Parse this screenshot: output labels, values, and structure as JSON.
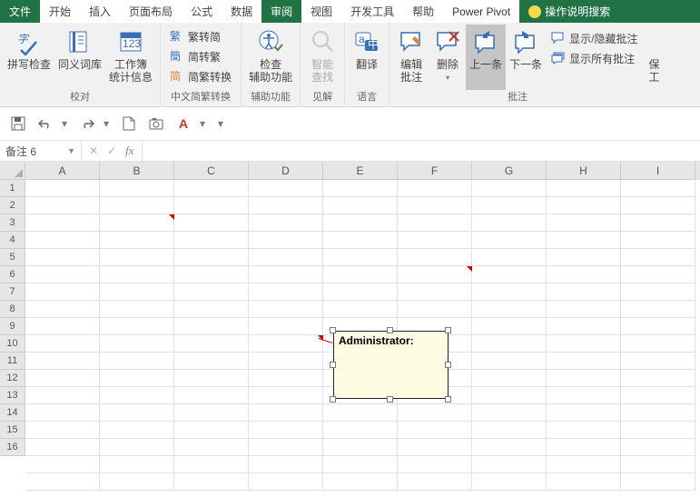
{
  "menu": {
    "file": "文件",
    "tabs": [
      "开始",
      "插入",
      "页面布局",
      "公式",
      "数据",
      "审阅",
      "视图",
      "开发工具",
      "帮助",
      "Power Pivot"
    ],
    "active_index": 5,
    "tellme": "操作说明搜索"
  },
  "ribbon": {
    "spell": "拼写检查",
    "thesaurus": "同义词库",
    "stats": "工作簿\n统计信息",
    "group_proof": "校对",
    "cn1": "繁转简",
    "cn2": "简转繁",
    "cn3": "简繁转换",
    "group_cn": "中文简繁转换",
    "acc_check": "检查\n辅助功能",
    "group_acc": "辅助功能",
    "smart": "智能\n查找",
    "group_in": "见解",
    "translate": "翻译",
    "group_lang": "语言",
    "edit_note": "编辑\n批注",
    "delete": "删除",
    "prev": "上一条",
    "next": "下一条",
    "showhide": "显示/隐藏批注",
    "showall": "显示所有批注",
    "group_note": "批注",
    "protect": "保\n工"
  },
  "namebox": "备注 6",
  "cols": [
    "A",
    "B",
    "C",
    "D",
    "E",
    "F",
    "G",
    "H",
    "I"
  ],
  "rows": [
    "1",
    "2",
    "3",
    "4",
    "5",
    "6",
    "7",
    "8",
    "9",
    "10",
    "11",
    "12",
    "13",
    "14",
    "15",
    "16"
  ],
  "comment_text": "Administrator:"
}
